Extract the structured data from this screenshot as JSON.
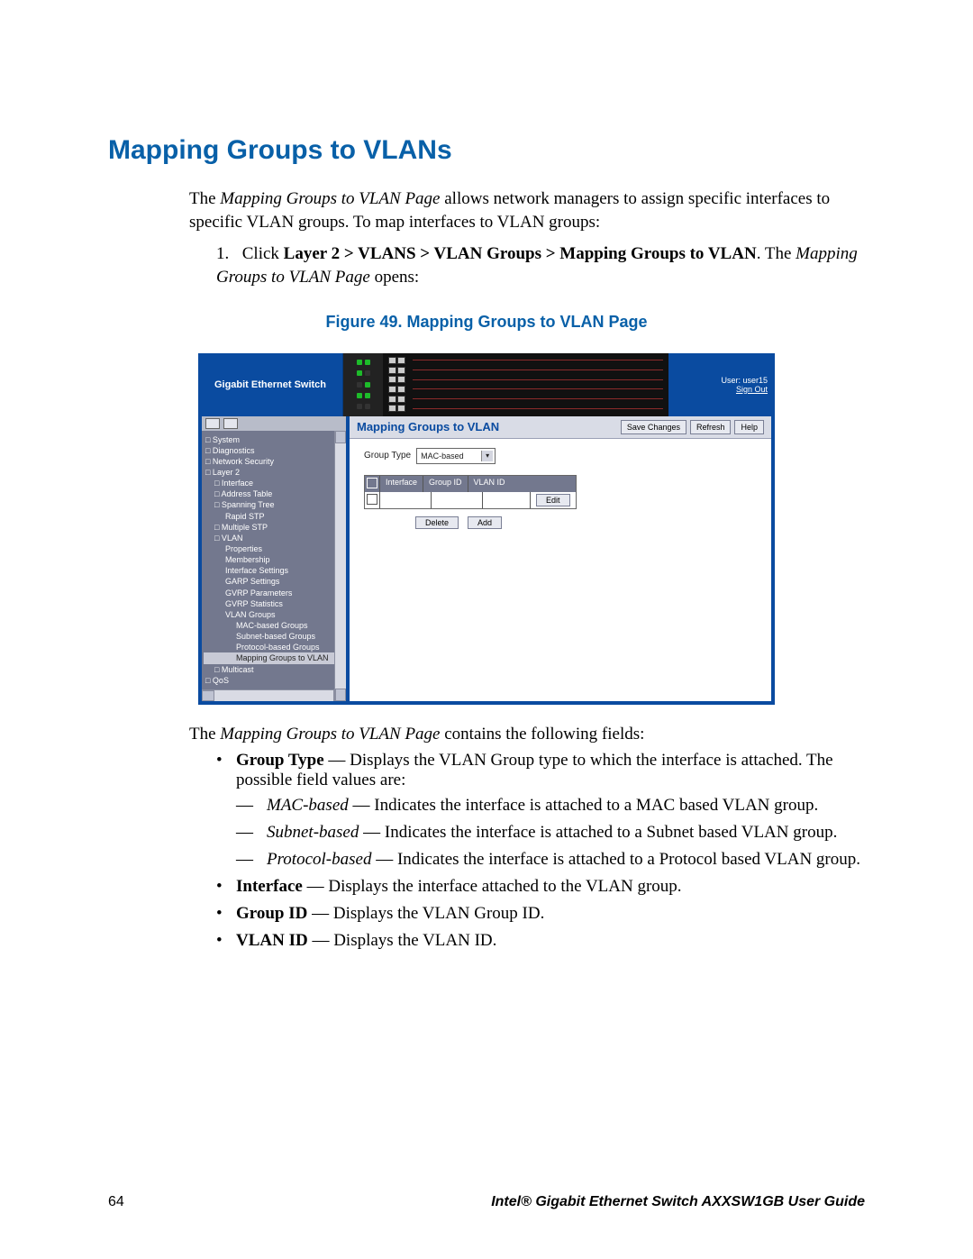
{
  "heading": "Mapping Groups to VLANs",
  "intro_prefix": "The ",
  "intro_em": "Mapping Groups to VLAN Page",
  "intro_suffix": " allows network managers to assign specific interfaces to specific VLAN groups. To map interfaces to VLAN groups:",
  "step1_num": "1.",
  "step1_a": "Click ",
  "step1_b_bold": "Layer 2 > VLANS > VLAN Groups > Mapping Groups to VLAN",
  "step1_c": ". The ",
  "step1_d_em": "Mapping Groups to VLAN Page",
  "step1_e": " opens:",
  "figure_caption": "Figure 49. Mapping Groups to VLAN Page",
  "screenshot": {
    "brand": "Gigabit Ethernet Switch",
    "user_label": "User: user15",
    "signout": "Sign Out",
    "page_title": "Mapping Groups to VLAN",
    "buttons": {
      "save": "Save Changes",
      "refresh": "Refresh",
      "help": "Help"
    },
    "group_type_label": "Group Type",
    "group_type_value": "MAC-based",
    "table": {
      "cols": [
        "",
        "Interface",
        "Group ID",
        "VLAN ID"
      ],
      "edit": "Edit"
    },
    "actions": {
      "delete": "Delete",
      "add": "Add"
    },
    "nav": [
      {
        "lv": 1,
        "t": "System"
      },
      {
        "lv": 1,
        "t": "Diagnostics"
      },
      {
        "lv": 1,
        "t": "Network Security"
      },
      {
        "lv": 1,
        "t": "Layer 2"
      },
      {
        "lv": 2,
        "t": "Interface"
      },
      {
        "lv": 2,
        "t": "Address Table"
      },
      {
        "lv": 2,
        "t": "Spanning Tree"
      },
      {
        "lv": 3,
        "t": "Rapid STP"
      },
      {
        "lv": 2,
        "t": "Multiple STP"
      },
      {
        "lv": 2,
        "t": "VLAN"
      },
      {
        "lv": 3,
        "t": "Properties"
      },
      {
        "lv": 3,
        "t": "Membership"
      },
      {
        "lv": 3,
        "t": "Interface Settings"
      },
      {
        "lv": 3,
        "t": "GARP Settings"
      },
      {
        "lv": 3,
        "t": "GVRP Parameters"
      },
      {
        "lv": 3,
        "t": "GVRP Statistics"
      },
      {
        "lv": 3,
        "t": "VLAN Groups"
      },
      {
        "lv": 4,
        "t": "MAC-based Groups"
      },
      {
        "lv": 4,
        "t": "Subnet-based Groups"
      },
      {
        "lv": 4,
        "t": "Protocol-based Groups"
      },
      {
        "lv": 4,
        "t": "Mapping Groups to VLAN",
        "sel": true
      },
      {
        "lv": 2,
        "t": "Multicast"
      },
      {
        "lv": 1,
        "t": "QoS"
      }
    ]
  },
  "after_fig_prefix": "The ",
  "after_fig_em": "Mapping Groups to VLAN Page",
  "after_fig_suffix": " contains the following fields:",
  "fields": {
    "group_type_label": "Group Type",
    "group_type_desc": " — Displays the VLAN Group type to which the interface is attached. The possible field values are:",
    "mac_label": "MAC-based",
    "mac_desc": " — Indicates the interface is attached to a MAC based VLAN group.",
    "subnet_label": "Subnet-based",
    "subnet_desc": " — Indicates the interface is attached to a Subnet based VLAN group.",
    "protocol_label": "Protocol-based",
    "protocol_desc": " — Indicates the interface is attached to a Protocol based VLAN group.",
    "interface_label": "Interface",
    "interface_desc": " — Displays the interface attached to the VLAN group.",
    "groupid_label": "Group ID",
    "groupid_desc": " — Displays the VLAN Group ID.",
    "vlanid_label": "VLAN ID",
    "vlanid_desc": " — Displays the VLAN ID."
  },
  "footer": {
    "page": "64",
    "guide": "Intel® Gigabit Ethernet Switch AXXSW1GB User Guide"
  }
}
